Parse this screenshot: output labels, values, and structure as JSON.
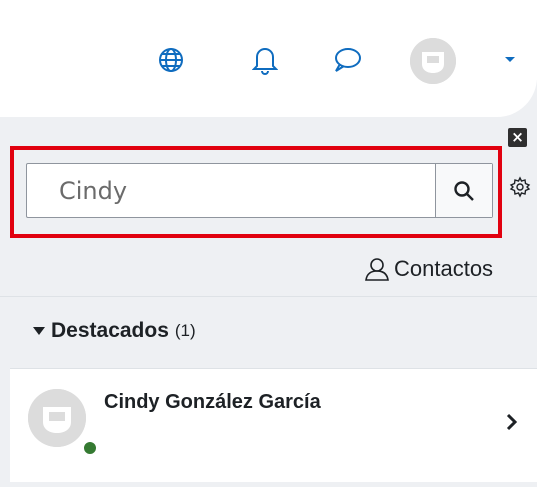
{
  "topbar": {
    "icons": [
      "globe-icon",
      "bell-icon",
      "chat-icon"
    ],
    "avatar": "user-avatar",
    "menu": "caret-down-icon",
    "accent_color": "#0f6cbf"
  },
  "drawer": {
    "close_label": "×",
    "search": {
      "value": "Cindy",
      "button_icon": "search-icon",
      "highlight_color": "#e1000f"
    },
    "settings_icon": "gear-icon",
    "contacts_link": "Contactos",
    "section": {
      "label": "Destacados",
      "count": "(1)"
    },
    "contacts": [
      {
        "name": "Cindy González García",
        "status": "online",
        "status_color": "#357a32"
      }
    ]
  }
}
